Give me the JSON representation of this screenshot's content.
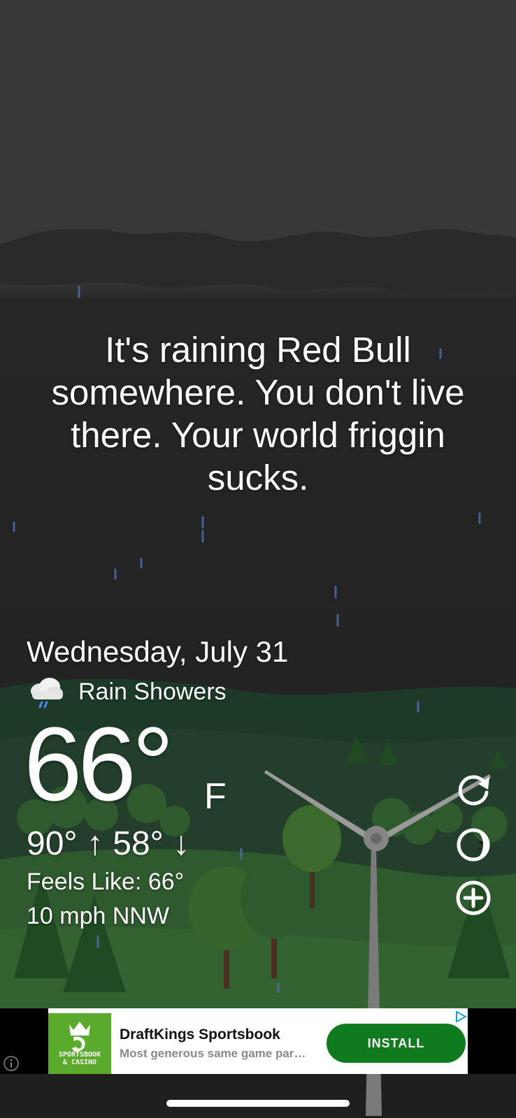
{
  "quote": "It's raining Red Bull somewhere. You don't live there. Your world friggin sucks.",
  "weather": {
    "date": "Wednesday, July 31",
    "condition": "Rain Showers",
    "condition_icon": "rain-cloud-icon",
    "temperature": "66°",
    "unit": "F",
    "high_low": "90° ↑  58° ↓",
    "feels_like": "Feels Like: 66°",
    "wind": "10 mph NNW"
  },
  "side_buttons": [
    {
      "name": "refresh-icon"
    },
    {
      "name": "moon-phase-icon"
    },
    {
      "name": "add-location-icon"
    }
  ],
  "ad": {
    "logo_text_line1": "SPORTSBOOK",
    "logo_text_line2": "& CASINO",
    "title": "DraftKings Sportsbook",
    "subtitle": "Most generous same game par…",
    "install_label": "INSTALL"
  },
  "colors": {
    "sky": "#202020",
    "clouds": "#3a3a3a",
    "hills": "#2f5a2e",
    "ad_button": "#0f7a1e",
    "ad_logo": "#5aaa2c"
  }
}
